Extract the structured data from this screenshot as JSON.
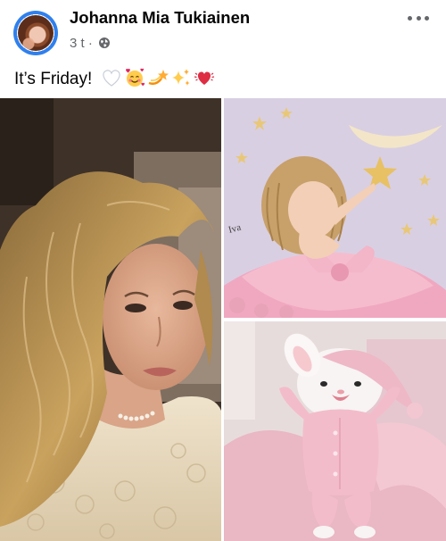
{
  "post": {
    "author": "Johanna Mia Tukiainen",
    "time": "3 t ·",
    "privacy_icon": "globe-icon",
    "text": "It’s Friday!",
    "emojis": [
      "white-heart",
      "smiling-face-with-hearts",
      "dizzy",
      "sparkles",
      "beating-heart"
    ]
  },
  "photos": [
    {
      "name": "photo-woman-selfie"
    },
    {
      "name": "photo-doll-stars"
    },
    {
      "name": "photo-bunny-pajamas"
    }
  ],
  "colors": {
    "text": "#050505",
    "meta": "#65676b",
    "avatar_ring": "#2f80ed",
    "background": "#ffffff"
  }
}
